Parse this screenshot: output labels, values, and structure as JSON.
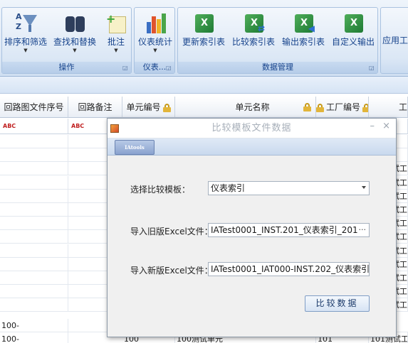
{
  "ribbon": {
    "groups": [
      {
        "label": "操作"
      },
      {
        "label": "仪表..."
      },
      {
        "label": "数据管理"
      }
    ],
    "buttons": {
      "sort_filter": "排序和筛选",
      "find_replace": "查找和替换",
      "annotate": "批注",
      "instrument_stats": "仪表统计",
      "update_index": "更新索引表",
      "compare_index": "比较索引表",
      "export_index": "输出索引表",
      "custom_export": "自定义输出",
      "apply_tools": "应用工"
    }
  },
  "grid": {
    "columns": [
      "回路图文件序号",
      "回路备注",
      "单元编号",
      "单元名称",
      "工厂编号",
      "工"
    ],
    "filter_glyph": "ABC",
    "row_fragments": {
      "col1_a": "100-",
      "col1_b": "100-",
      "col3": "100",
      "col4": "100测试单元",
      "col5": "101",
      "col6": "101测试工",
      "right_edge": "试工"
    }
  },
  "dialog": {
    "title": "比较模板文件数据",
    "min_glyph": "–",
    "close_glyph": "×",
    "tab_label": "IAtools",
    "template_label": "选择比较模板：",
    "template_value": "仪表索引",
    "old_label": "导入旧版Excel文件：",
    "old_value": "IATest0001_INST.201_仪表索引_201",
    "new_label": "导入新版Excel文件：",
    "new_value": "IATest0001_IAT000-INST.202_仪表索引",
    "browse_glyph": "···",
    "compare_button": "比较数据"
  }
}
